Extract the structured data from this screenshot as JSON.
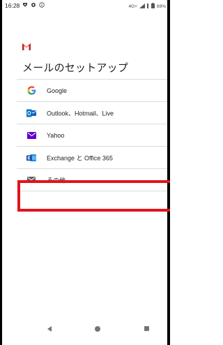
{
  "status_bar": {
    "time": "16:28",
    "icons_left": [
      "notification-icon",
      "settings-icon",
      "info-icon"
    ],
    "network": "4G+",
    "battery": "69%"
  },
  "header": {
    "logo": "gmail-logo",
    "title": "メールのセットアップ"
  },
  "providers": [
    {
      "label": "Google",
      "icon": "google-icon"
    },
    {
      "label": "Outlook、Hotmail、Live",
      "icon": "outlook-icon"
    },
    {
      "label": "Yahoo",
      "icon": "yahoo-icon"
    },
    {
      "label": "Exchange と Office 365",
      "icon": "exchange-icon"
    },
    {
      "label": "その他",
      "icon": "mail-icon"
    }
  ],
  "highlighted_item": "その他",
  "colors": {
    "highlight": "#e2131b",
    "gmail_red": "#ea4335",
    "google_blue": "#4285f4",
    "outlook_blue": "#0072c6",
    "yahoo_purple": "#5f01d1",
    "exchange_blue": "#1e88e5",
    "mail_gray": "#5f6368"
  },
  "nav": {
    "back": "back-icon",
    "home": "home-icon",
    "recents": "recents-icon"
  }
}
